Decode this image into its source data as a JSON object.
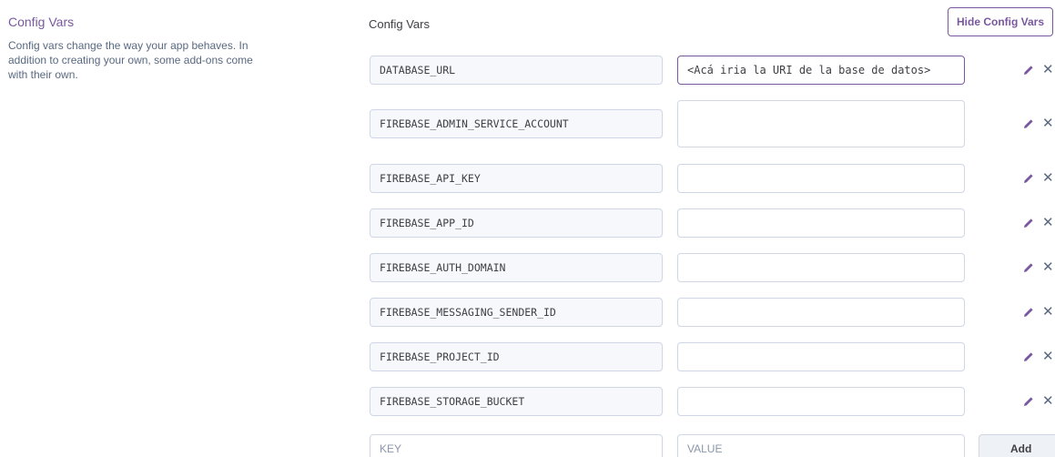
{
  "section": {
    "title": "Config Vars",
    "description": "Config vars change the way your app behaves. In addition to creating your own, some add-ons come with their own."
  },
  "panel": {
    "title": "Config Vars",
    "hide_button_label": "Hide Config Vars"
  },
  "vars": [
    {
      "key": "DATABASE_URL",
      "value": "<Acá iria la URI de la base de datos>"
    },
    {
      "key": "FIREBASE_ADMIN_SERVICE_ACCOUNT",
      "value": ""
    },
    {
      "key": "FIREBASE_API_KEY",
      "value": ""
    },
    {
      "key": "FIREBASE_APP_ID",
      "value": ""
    },
    {
      "key": "FIREBASE_AUTH_DOMAIN",
      "value": ""
    },
    {
      "key": "FIREBASE_MESSAGING_SENDER_ID",
      "value": ""
    },
    {
      "key": "FIREBASE_PROJECT_ID",
      "value": ""
    },
    {
      "key": "FIREBASE_STORAGE_BUCKET",
      "value": ""
    }
  ],
  "new_var": {
    "key_placeholder": "KEY",
    "value_placeholder": "VALUE",
    "add_label": "Add"
  },
  "icons": {
    "edit": "pencil-icon",
    "delete": "close-icon"
  },
  "colors": {
    "accent": "#79589f",
    "text": "#3f3f44",
    "muted": "#596981",
    "border": "#cfd7e6"
  }
}
